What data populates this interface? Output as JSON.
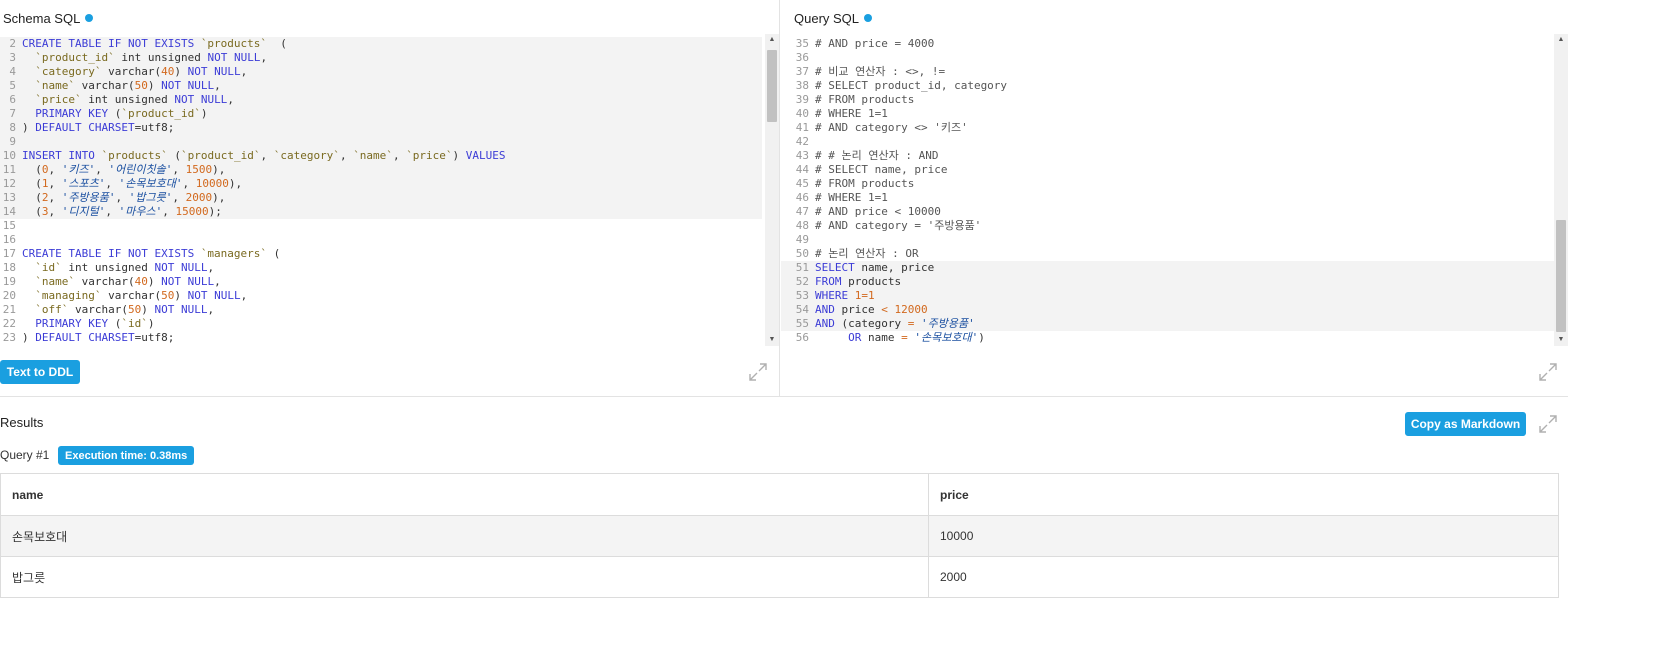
{
  "schema_pane": {
    "title": "Schema SQL",
    "lines": [
      {
        "n": "2",
        "hl": true,
        "tokens": [
          [
            "kw",
            "CREATE TABLE IF NOT EXISTS "
          ],
          [
            "id",
            "`products`"
          ],
          [
            "",
            "  ("
          ]
        ]
      },
      {
        "n": "3",
        "hl": true,
        "tokens": [
          [
            "",
            "  "
          ],
          [
            "id",
            "`product_id`"
          ],
          [
            "",
            " int unsigned "
          ],
          [
            "kw",
            "NOT NULL"
          ],
          [
            "",
            ","
          ]
        ]
      },
      {
        "n": "4",
        "hl": true,
        "tokens": [
          [
            "",
            "  "
          ],
          [
            "id",
            "`category`"
          ],
          [
            "",
            " varchar("
          ],
          [
            "num",
            "40"
          ],
          [
            "",
            ") "
          ],
          [
            "kw",
            "NOT NULL"
          ],
          [
            "",
            ","
          ]
        ]
      },
      {
        "n": "5",
        "hl": true,
        "tokens": [
          [
            "",
            "  "
          ],
          [
            "id",
            "`name`"
          ],
          [
            "",
            " varchar("
          ],
          [
            "num",
            "50"
          ],
          [
            "",
            ") "
          ],
          [
            "kw",
            "NOT NULL"
          ],
          [
            "",
            ","
          ]
        ]
      },
      {
        "n": "6",
        "hl": true,
        "tokens": [
          [
            "",
            "  "
          ],
          [
            "id",
            "`price`"
          ],
          [
            "",
            " int unsigned "
          ],
          [
            "kw",
            "NOT NULL"
          ],
          [
            "",
            ","
          ]
        ]
      },
      {
        "n": "7",
        "hl": true,
        "tokens": [
          [
            "",
            "  "
          ],
          [
            "kw",
            "PRIMARY KEY"
          ],
          [
            "",
            " ("
          ],
          [
            "id",
            "`product_id`"
          ],
          [
            "",
            ")"
          ]
        ]
      },
      {
        "n": "8",
        "hl": true,
        "tokens": [
          [
            "",
            ") "
          ],
          [
            "kw",
            "DEFAULT"
          ],
          [
            "",
            " "
          ],
          [
            "kw",
            "CHARSET"
          ],
          [
            "",
            "=utf8;"
          ]
        ]
      },
      {
        "n": "9",
        "hl": true,
        "tokens": [
          [
            "",
            ""
          ]
        ]
      },
      {
        "n": "10",
        "hl": true,
        "tokens": [
          [
            "kw",
            "INSERT INTO "
          ],
          [
            "id",
            "`products`"
          ],
          [
            "",
            " ("
          ],
          [
            "id",
            "`product_id`"
          ],
          [
            "",
            ", "
          ],
          [
            "id",
            "`category`"
          ],
          [
            "",
            ", "
          ],
          [
            "id",
            "`name`"
          ],
          [
            "",
            ", "
          ],
          [
            "id",
            "`price`"
          ],
          [
            "",
            ") "
          ],
          [
            "kw",
            "VALUES"
          ]
        ]
      },
      {
        "n": "11",
        "hl": true,
        "tokens": [
          [
            "",
            "  ("
          ],
          [
            "num",
            "0"
          ],
          [
            "",
            ", "
          ],
          [
            "str2",
            "'키즈'"
          ],
          [
            "",
            ", "
          ],
          [
            "str2",
            "'어린이칫솔'"
          ],
          [
            "",
            ", "
          ],
          [
            "num",
            "1500"
          ],
          [
            "",
            "),"
          ]
        ]
      },
      {
        "n": "12",
        "hl": true,
        "tokens": [
          [
            "",
            "  ("
          ],
          [
            "num",
            "1"
          ],
          [
            "",
            ", "
          ],
          [
            "str2",
            "'스포츠'"
          ],
          [
            "",
            ", "
          ],
          [
            "str2",
            "'손목보호대'"
          ],
          [
            "",
            ", "
          ],
          [
            "num",
            "10000"
          ],
          [
            "",
            "),"
          ]
        ]
      },
      {
        "n": "13",
        "hl": true,
        "tokens": [
          [
            "",
            "  ("
          ],
          [
            "num",
            "2"
          ],
          [
            "",
            ", "
          ],
          [
            "str2",
            "'주방용품'"
          ],
          [
            "",
            ", "
          ],
          [
            "str2",
            "'밥그릇'"
          ],
          [
            "",
            ", "
          ],
          [
            "num",
            "2000"
          ],
          [
            "",
            "),"
          ]
        ]
      },
      {
        "n": "14",
        "hl": true,
        "tokens": [
          [
            "",
            "  ("
          ],
          [
            "num",
            "3"
          ],
          [
            "",
            ", "
          ],
          [
            "str2",
            "'디지털'"
          ],
          [
            "",
            ", "
          ],
          [
            "str2",
            "'마우스'"
          ],
          [
            "",
            ", "
          ],
          [
            "num",
            "15000"
          ],
          [
            "",
            ");"
          ]
        ]
      },
      {
        "n": "15",
        "hl": false,
        "tokens": [
          [
            "",
            ""
          ]
        ]
      },
      {
        "n": "16",
        "hl": false,
        "tokens": [
          [
            "",
            ""
          ]
        ]
      },
      {
        "n": "17",
        "hl": false,
        "tokens": [
          [
            "kw",
            "CREATE TABLE IF NOT EXISTS "
          ],
          [
            "id",
            "`managers`"
          ],
          [
            "",
            " ("
          ]
        ]
      },
      {
        "n": "18",
        "hl": false,
        "tokens": [
          [
            "",
            "  "
          ],
          [
            "id",
            "`id`"
          ],
          [
            "",
            " int unsigned "
          ],
          [
            "kw",
            "NOT NULL"
          ],
          [
            "",
            ","
          ]
        ]
      },
      {
        "n": "19",
        "hl": false,
        "tokens": [
          [
            "",
            "  "
          ],
          [
            "id",
            "`name`"
          ],
          [
            "",
            " varchar("
          ],
          [
            "num",
            "40"
          ],
          [
            "",
            ") "
          ],
          [
            "kw",
            "NOT NULL"
          ],
          [
            "",
            ","
          ]
        ]
      },
      {
        "n": "20",
        "hl": false,
        "tokens": [
          [
            "",
            "  "
          ],
          [
            "id",
            "`managing`"
          ],
          [
            "",
            " varchar("
          ],
          [
            "num",
            "50"
          ],
          [
            "",
            ") "
          ],
          [
            "kw",
            "NOT NULL"
          ],
          [
            "",
            ","
          ]
        ]
      },
      {
        "n": "21",
        "hl": false,
        "tokens": [
          [
            "",
            "  "
          ],
          [
            "id",
            "`off`"
          ],
          [
            "",
            " varchar("
          ],
          [
            "num",
            "50"
          ],
          [
            "",
            ") "
          ],
          [
            "kw",
            "NOT NULL"
          ],
          [
            "",
            ","
          ]
        ]
      },
      {
        "n": "22",
        "hl": false,
        "tokens": [
          [
            "",
            "  "
          ],
          [
            "kw",
            "PRIMARY KEY"
          ],
          [
            "",
            " ("
          ],
          [
            "id",
            "`id`"
          ],
          [
            "",
            ")"
          ]
        ]
      },
      {
        "n": "23",
        "hl": false,
        "tokens": [
          [
            "",
            ") "
          ],
          [
            "kw",
            "DEFAULT"
          ],
          [
            "",
            " "
          ],
          [
            "kw",
            "CHARSET"
          ],
          [
            "",
            "=utf8;"
          ]
        ]
      }
    ]
  },
  "query_pane": {
    "title": "Query SQL",
    "lines": [
      {
        "n": "35",
        "hl": false,
        "tokens": [
          [
            "cmt",
            "# AND price = 4000"
          ]
        ]
      },
      {
        "n": "36",
        "hl": false,
        "tokens": [
          [
            "",
            ""
          ]
        ]
      },
      {
        "n": "37",
        "hl": false,
        "tokens": [
          [
            "cmt",
            "# 비교 연산자 : <>, !="
          ]
        ]
      },
      {
        "n": "38",
        "hl": false,
        "tokens": [
          [
            "cmt",
            "# SELECT product_id, category"
          ]
        ]
      },
      {
        "n": "39",
        "hl": false,
        "tokens": [
          [
            "cmt",
            "# FROM products"
          ]
        ]
      },
      {
        "n": "40",
        "hl": false,
        "tokens": [
          [
            "cmt",
            "# WHERE 1=1"
          ]
        ]
      },
      {
        "n": "41",
        "hl": false,
        "tokens": [
          [
            "cmt",
            "# AND category <> '키즈'"
          ]
        ]
      },
      {
        "n": "42",
        "hl": false,
        "tokens": [
          [
            "",
            ""
          ]
        ]
      },
      {
        "n": "43",
        "hl": false,
        "tokens": [
          [
            "cmt",
            "# # 논리 연산자 : AND"
          ]
        ]
      },
      {
        "n": "44",
        "hl": false,
        "tokens": [
          [
            "cmt",
            "# SELECT name, price"
          ]
        ]
      },
      {
        "n": "45",
        "hl": false,
        "tokens": [
          [
            "cmt",
            "# FROM products"
          ]
        ]
      },
      {
        "n": "46",
        "hl": false,
        "tokens": [
          [
            "cmt",
            "# WHERE 1=1"
          ]
        ]
      },
      {
        "n": "47",
        "hl": false,
        "tokens": [
          [
            "cmt",
            "# AND price < 10000"
          ]
        ]
      },
      {
        "n": "48",
        "hl": false,
        "tokens": [
          [
            "cmt",
            "# AND category = '주방용품'"
          ]
        ]
      },
      {
        "n": "49",
        "hl": false,
        "tokens": [
          [
            "",
            ""
          ]
        ]
      },
      {
        "n": "50",
        "hl": false,
        "tokens": [
          [
            "cmt",
            "# 논리 연산자 : OR"
          ]
        ]
      },
      {
        "n": "51",
        "hl": true,
        "tokens": [
          [
            "kw",
            "SELECT"
          ],
          [
            "",
            " name, price"
          ]
        ]
      },
      {
        "n": "52",
        "hl": true,
        "tokens": [
          [
            "kw",
            "FROM"
          ],
          [
            "",
            " products"
          ]
        ]
      },
      {
        "n": "53",
        "hl": true,
        "tokens": [
          [
            "kw",
            "WHERE"
          ],
          [
            "",
            " "
          ],
          [
            "num",
            "1"
          ],
          [
            "op",
            "="
          ],
          [
            "num",
            "1"
          ]
        ]
      },
      {
        "n": "54",
        "hl": true,
        "tokens": [
          [
            "kw",
            "AND"
          ],
          [
            "",
            " price "
          ],
          [
            "op",
            "<"
          ],
          [
            "",
            " "
          ],
          [
            "num",
            "12000"
          ]
        ]
      },
      {
        "n": "55",
        "hl": true,
        "tokens": [
          [
            "kw",
            "AND"
          ],
          [
            "",
            " (category "
          ],
          [
            "op",
            "="
          ],
          [
            "",
            " "
          ],
          [
            "str2",
            "'주방용품'"
          ]
        ]
      },
      {
        "n": "56",
        "hl": false,
        "tokens": [
          [
            "",
            "     "
          ],
          [
            "kw",
            "OR"
          ],
          [
            "",
            " name "
          ],
          [
            "op",
            "="
          ],
          [
            "",
            " "
          ],
          [
            "str2",
            "'손목보호대'"
          ],
          [
            "",
            ")"
          ]
        ]
      }
    ]
  },
  "buttons": {
    "text_to_ddl": "Text to DDL",
    "copy_markdown": "Copy as Markdown"
  },
  "results": {
    "title": "Results",
    "query_label": "Query #1",
    "execution_time": "Execution time: 0.38ms",
    "columns": [
      "name",
      "price"
    ],
    "rows": [
      [
        "손목보호대",
        "10000"
      ],
      [
        "밥그릇",
        "2000"
      ]
    ]
  },
  "colors": {
    "accent": "#1a9fe0",
    "keyword": "#3c3cd6",
    "number": "#d2691e",
    "string": "#1a4fa0",
    "identifier": "#7a6a20"
  }
}
